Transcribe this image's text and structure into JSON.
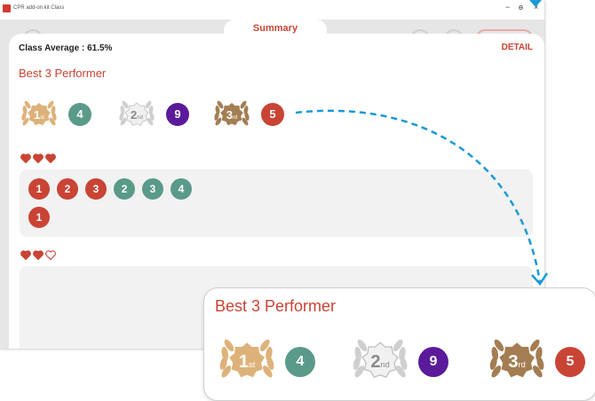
{
  "window": {
    "title": "CPR add-on kit Class"
  },
  "controls": {
    "minimize": "−",
    "maximize": "ɵ",
    "close": "×"
  },
  "header": {
    "tab_label": "Summary"
  },
  "summary": {
    "class_average": "Class Average : 61.5%",
    "detail_label": "DETAIL",
    "best_title": "Best 3 Performer"
  },
  "performers": [
    {
      "medal": "1",
      "suffix": "st",
      "number": "4",
      "color": "#5a9a89",
      "medal_color": "#ddb27a"
    },
    {
      "medal": "2",
      "suffix": "nd",
      "number": "9",
      "color": "#5b1a9a",
      "medal_color": "#cfcfcf"
    },
    {
      "medal": "3",
      "suffix": "rd",
      "number": "5",
      "color": "#c94434",
      "medal_color": "#a47d52"
    }
  ],
  "groups": [
    {
      "hearts": [
        "full",
        "full",
        "full"
      ],
      "chips": [
        "1",
        "2",
        "3",
        "2",
        "3",
        "4",
        "1"
      ]
    },
    {
      "hearts": [
        "full",
        "full",
        "empty"
      ],
      "chips": []
    }
  ],
  "zoom": {
    "best_title": "Best 3 Performer"
  },
  "colors": {
    "accent": "#c94434",
    "teal": "#5a9a89",
    "purple": "#5b1a9a",
    "arrow": "#1a9ad6"
  }
}
